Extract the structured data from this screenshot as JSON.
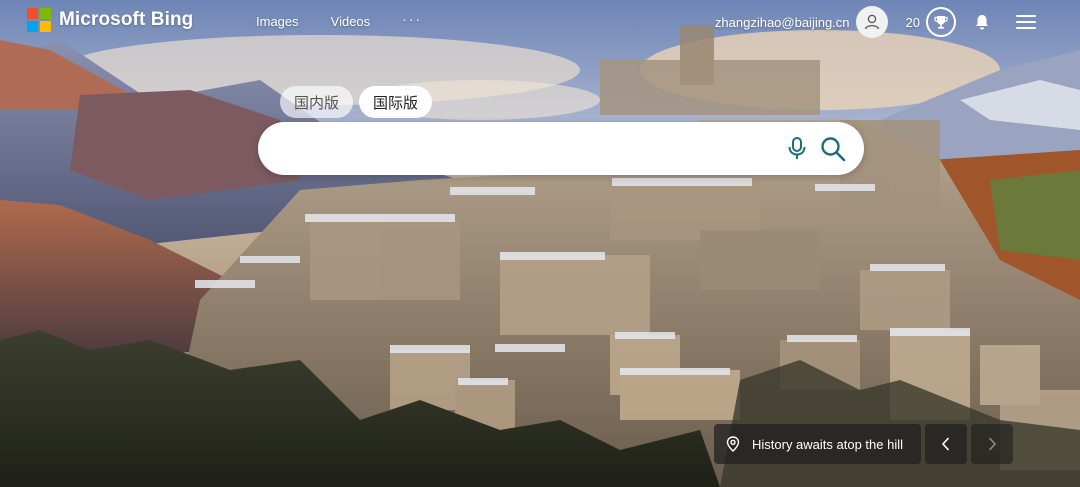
{
  "brand": {
    "name": "Microsoft Bing",
    "logo_colors": [
      "#F25022",
      "#7FBA00",
      "#00A4EF",
      "#FFB900"
    ]
  },
  "nav": {
    "items": [
      "Images",
      "Videos"
    ],
    "more": "···"
  },
  "user": {
    "email": "zhangzihao@baijing.cn",
    "points": "20"
  },
  "region_tabs": [
    {
      "label": "国内版",
      "selected": false
    },
    {
      "label": "国际版",
      "selected": true
    }
  ],
  "search": {
    "value": "",
    "placeholder": ""
  },
  "caption": {
    "text": "History awaits atop the hill"
  },
  "colors": {
    "accent": "#1c6e7d",
    "caption_bg": "#1e1e1e"
  },
  "icons": {
    "mic": "microphone-icon",
    "search": "search-icon",
    "avatar": "user-icon",
    "trophy": "trophy-icon",
    "bell": "bell-icon",
    "menu": "hamburger-icon",
    "pin": "location-pin-icon",
    "prev": "chevron-left-icon",
    "next": "chevron-right-icon"
  }
}
